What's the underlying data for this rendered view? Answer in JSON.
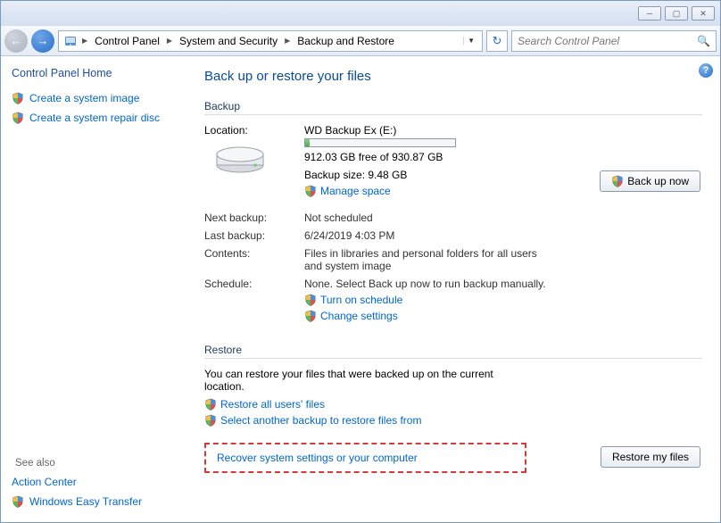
{
  "titlebar": {},
  "toolbar": {
    "breadcrumbs": [
      "Control Panel",
      "System and Security",
      "Backup and Restore"
    ],
    "search_placeholder": "Search Control Panel"
  },
  "sidebar": {
    "home": "Control Panel Home",
    "tasks": [
      "Create a system image",
      "Create a system repair disc"
    ],
    "seealso_label": "See also",
    "seealso": [
      "Action Center",
      "Windows Easy Transfer"
    ]
  },
  "main": {
    "title": "Back up or restore your files",
    "backup_header": "Backup",
    "location_label": "Location:",
    "location_value": "WD Backup Ex  (E:)",
    "free_space": "912.03 GB free of 930.87 GB",
    "backup_size": "Backup size: 9.48 GB",
    "manage_space": "Manage space",
    "next_backup_label": "Next backup:",
    "next_backup_value": "Not scheduled",
    "last_backup_label": "Last backup:",
    "last_backup_value": "6/24/2019 4:03 PM",
    "contents_label": "Contents:",
    "contents_value": "Files in libraries and personal folders for all users and system image",
    "schedule_label": "Schedule:",
    "schedule_value": "None. Select Back up now to run backup manually.",
    "turn_on_schedule": "Turn on schedule",
    "change_settings": "Change settings",
    "backup_now_btn": "Back up now",
    "restore_header": "Restore",
    "restore_text": "You can restore your files that were backed up on the current location.",
    "restore_all": "Restore all users' files",
    "select_another": "Select another backup to restore files from",
    "restore_btn": "Restore my files",
    "recover_link": "Recover system settings or your computer"
  }
}
